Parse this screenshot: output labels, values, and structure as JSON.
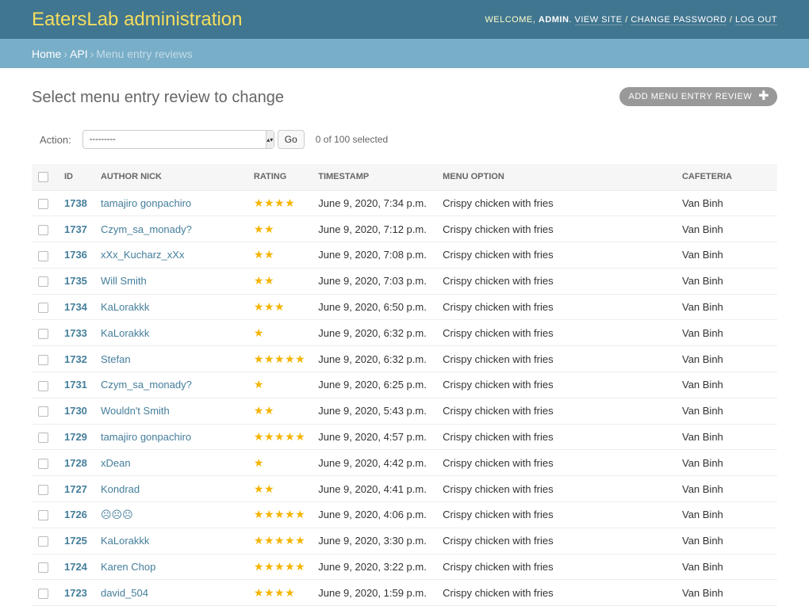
{
  "header": {
    "brand": "EatersLab administration",
    "welcome": "Welcome,",
    "user": "admin",
    "view_site": "View site",
    "change_password": "Change password",
    "log_out": "Log out"
  },
  "breadcrumbs": {
    "home": "Home",
    "api": "API",
    "current": "Menu entry reviews"
  },
  "page": {
    "title": "Select menu entry review to change",
    "add_label": "Add menu entry review"
  },
  "actions": {
    "label": "Action:",
    "selected_value": "---------",
    "go_label": "Go",
    "selected_count": "0 of 100 selected"
  },
  "table": {
    "headers": {
      "id": "ID",
      "author": "Author nick",
      "rating": "Rating",
      "timestamp": "Timestamp",
      "menu_option": "Menu option",
      "cafeteria": "Cafeteria"
    },
    "rows": [
      {
        "id": "1738",
        "author": "tamajiro gonpachiro",
        "rating": 4,
        "timestamp": "June 9, 2020, 7:34 p.m.",
        "menu_option": "Crispy chicken with fries",
        "cafeteria": "Van Binh"
      },
      {
        "id": "1737",
        "author": "Czym_sa_monady?",
        "rating": 2,
        "timestamp": "June 9, 2020, 7:12 p.m.",
        "menu_option": "Crispy chicken with fries",
        "cafeteria": "Van Binh"
      },
      {
        "id": "1736",
        "author": "xXx_Kucharz_xXx",
        "rating": 2,
        "timestamp": "June 9, 2020, 7:08 p.m.",
        "menu_option": "Crispy chicken with fries",
        "cafeteria": "Van Binh"
      },
      {
        "id": "1735",
        "author": "Will Smith",
        "rating": 2,
        "timestamp": "June 9, 2020, 7:03 p.m.",
        "menu_option": "Crispy chicken with fries",
        "cafeteria": "Van Binh"
      },
      {
        "id": "1734",
        "author": "KaLorakkk",
        "rating": 3,
        "timestamp": "June 9, 2020, 6:50 p.m.",
        "menu_option": "Crispy chicken with fries",
        "cafeteria": "Van Binh"
      },
      {
        "id": "1733",
        "author": "KaLorakkk",
        "rating": 1,
        "timestamp": "June 9, 2020, 6:32 p.m.",
        "menu_option": "Crispy chicken with fries",
        "cafeteria": "Van Binh"
      },
      {
        "id": "1732",
        "author": "Stefan",
        "rating": 5,
        "timestamp": "June 9, 2020, 6:32 p.m.",
        "menu_option": "Crispy chicken with fries",
        "cafeteria": "Van Binh"
      },
      {
        "id": "1731",
        "author": "Czym_sa_monady?",
        "rating": 1,
        "timestamp": "June 9, 2020, 6:25 p.m.",
        "menu_option": "Crispy chicken with fries",
        "cafeteria": "Van Binh"
      },
      {
        "id": "1730",
        "author": "Wouldn't Smith",
        "rating": 2,
        "timestamp": "June 9, 2020, 5:43 p.m.",
        "menu_option": "Crispy chicken with fries",
        "cafeteria": "Van Binh"
      },
      {
        "id": "1729",
        "author": "tamajiro gonpachiro",
        "rating": 5,
        "timestamp": "June 9, 2020, 4:57 p.m.",
        "menu_option": "Crispy chicken with fries",
        "cafeteria": "Van Binh"
      },
      {
        "id": "1728",
        "author": "xDean",
        "rating": 1,
        "timestamp": "June 9, 2020, 4:42 p.m.",
        "menu_option": "Crispy chicken with fries",
        "cafeteria": "Van Binh"
      },
      {
        "id": "1727",
        "author": "Kondrad",
        "rating": 2,
        "timestamp": "June 9, 2020, 4:41 p.m.",
        "menu_option": "Crispy chicken with fries",
        "cafeteria": "Van Binh"
      },
      {
        "id": "1726",
        "author": "☹☹☹",
        "rating": 5,
        "timestamp": "June 9, 2020, 4:06 p.m.",
        "menu_option": "Crispy chicken with fries",
        "cafeteria": "Van Binh"
      },
      {
        "id": "1725",
        "author": "KaLorakkk",
        "rating": 5,
        "timestamp": "June 9, 2020, 3:30 p.m.",
        "menu_option": "Crispy chicken with fries",
        "cafeteria": "Van Binh"
      },
      {
        "id": "1724",
        "author": "Karen Chop",
        "rating": 5,
        "timestamp": "June 9, 2020, 3:22 p.m.",
        "menu_option": "Crispy chicken with fries",
        "cafeteria": "Van Binh"
      },
      {
        "id": "1723",
        "author": "david_504",
        "rating": 4,
        "timestamp": "June 9, 2020, 1:59 p.m.",
        "menu_option": "Crispy chicken with fries",
        "cafeteria": "Van Binh"
      }
    ]
  },
  "colors": {
    "header_bg": "#417690",
    "brand_text": "#f5dd5d",
    "breadcrumbs_bg": "#79aec8",
    "link": "#447e9b",
    "star": "#f5b400",
    "add_button_bg": "#999999"
  },
  "icons": {
    "star": "star-icon",
    "add": "plus-icon",
    "select_arrow": "updown-arrow-icon"
  }
}
